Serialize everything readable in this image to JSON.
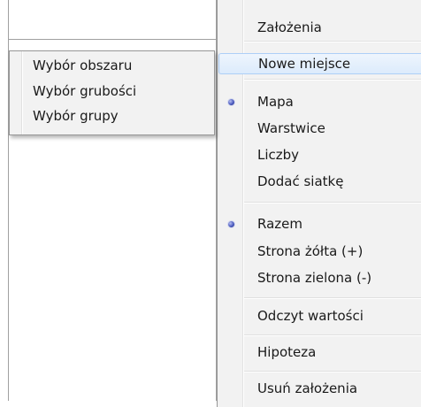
{
  "submenu": {
    "items": [
      {
        "label": "Wybór obszaru"
      },
      {
        "label": "Wybór grubości"
      },
      {
        "label": "Wybór grupy"
      }
    ]
  },
  "context_menu": {
    "items": [
      {
        "label": "Założenia",
        "highlighted": false
      },
      {
        "label": "Nowe miejsce",
        "highlighted": true
      },
      {
        "label": "Mapa",
        "checked": true
      },
      {
        "label": "Warstwice"
      },
      {
        "label": "Liczby"
      },
      {
        "label": "Dodać siatkę"
      },
      {
        "label": "Razem",
        "checked": true
      },
      {
        "label": "Strona żółta (+)"
      },
      {
        "label": "Strona zielona (-)"
      },
      {
        "label": "Odczyt wartości"
      },
      {
        "label": "Hipoteza"
      },
      {
        "label": "Usuń założenia"
      }
    ]
  },
  "colors": {
    "menu_background": "#f2f2f2",
    "highlight_border": "#aecff7",
    "radio_bullet": "#4c5cc0"
  }
}
